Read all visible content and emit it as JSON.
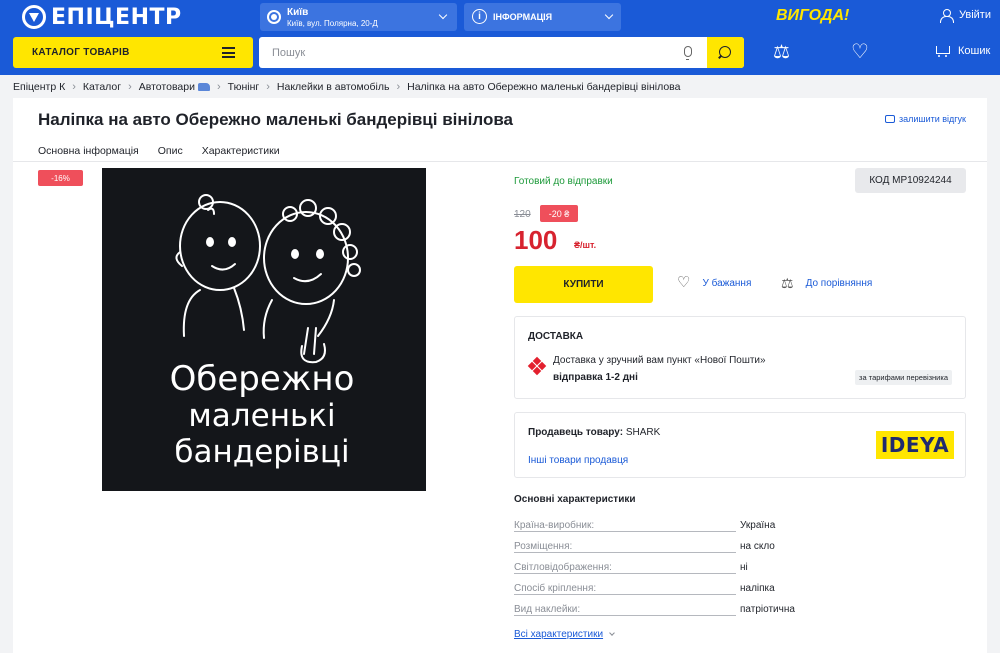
{
  "header": {
    "logo_text": "ЕПІЦЕНТР",
    "city": {
      "name": "Київ",
      "address": "Київ, вул. Полярна, 20-Д"
    },
    "info_label": "ІНФОРМАЦІЯ",
    "vygoda": "ВИГОДА!",
    "login_label": "Увійти",
    "catalog_label": "КАТАЛОГ ТОВАРІВ",
    "search_placeholder": "Пошук",
    "cart_label": "Кошик"
  },
  "breadcrumb": [
    "Епіцентр К",
    "Каталог",
    "Автотовари",
    "Тюнінг",
    "Наклейки в автомобіль",
    "Наліпка на авто Обережно маленькі бандерівці вінілова"
  ],
  "product": {
    "title": "Наліпка на авто Обережно маленькі бандерівці вінілова",
    "review_label": "залишити відгук",
    "tabs": [
      "Основна інформація",
      "Опис",
      "Характеристики"
    ],
    "discount_badge": "-16%",
    "image_text": [
      "Обережно",
      "маленькі",
      "бандерівці"
    ],
    "availability": "Готовий до відправки",
    "code": "КОД MP10924244",
    "old_price": "120",
    "price_discount": "-20 ₴",
    "price": "100",
    "price_unit": "₴/шт.",
    "buy_label": "КУПИТИ",
    "wishlist_label": "У бажання",
    "compare_label": "До порівняння"
  },
  "delivery": {
    "title": "ДОСТАВКА",
    "text": "Доставка у зручний вам пункт «Нової Пошти»",
    "days": "відправка 1-2 дні",
    "tariff": "за тарифами перевізника"
  },
  "seller": {
    "label": "Продавець товару:",
    "name": "SHARK",
    "link": "Інші товари продавця",
    "logo_text": "IDEYA"
  },
  "characteristics": {
    "title": "Основні характеристики",
    "rows": [
      {
        "name": "Країна-виробник:",
        "value": "Україна"
      },
      {
        "name": "Розміщення:",
        "value": "на скло"
      },
      {
        "name": "Світловідображення:",
        "value": "ні"
      },
      {
        "name": "Спосіб кріплення:",
        "value": "наліпка"
      },
      {
        "name": "Вид наклейки:",
        "value": "патріотична"
      }
    ],
    "all_link": "Всі характеристики"
  },
  "colors": {
    "brand_blue": "#1a5ad7",
    "accent_yellow": "#ffe600",
    "price_red": "#d7232f",
    "badge_red": "#ef4f5b",
    "ready_green": "#1d9a3a"
  }
}
